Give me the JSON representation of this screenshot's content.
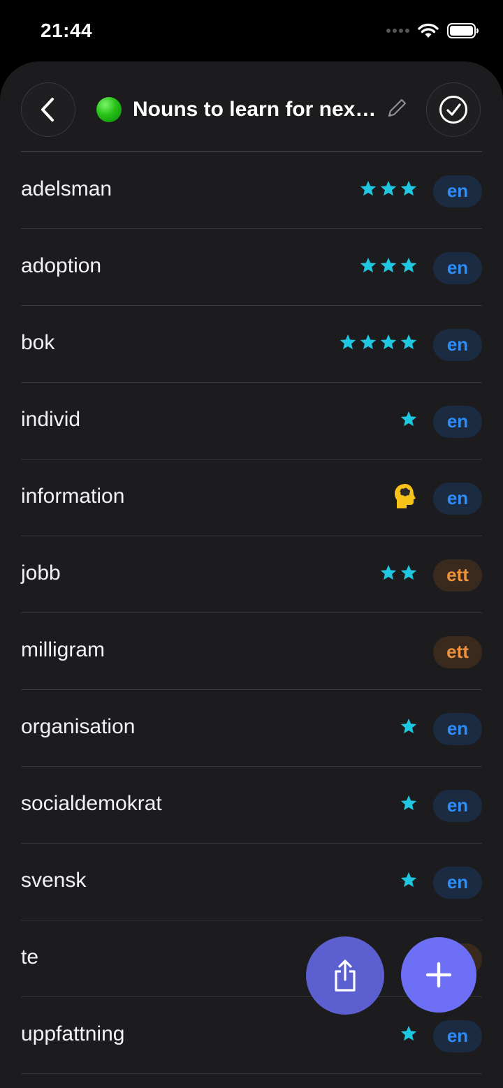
{
  "status": {
    "time": "21:44"
  },
  "header": {
    "title": "Nouns to learn for nex…",
    "back_icon": "chevron-left-icon",
    "edit_icon": "pencil-icon",
    "done_icon": "checkmark-circle-icon",
    "list_color": "#2ecc1f"
  },
  "colors": {
    "star": "#1fc7e0",
    "en": "#2e8cf6",
    "ett": "#f0913b"
  },
  "words": [
    {
      "word": "adelsman",
      "stars": 3,
      "article": "en"
    },
    {
      "word": "adoption",
      "stars": 3,
      "article": "en"
    },
    {
      "word": "bok",
      "stars": 4,
      "article": "en"
    },
    {
      "word": "individ",
      "stars": 1,
      "article": "en"
    },
    {
      "word": "information",
      "stars": 0,
      "brain": true,
      "article": "en"
    },
    {
      "word": "jobb",
      "stars": 2,
      "article": "ett"
    },
    {
      "word": "milligram",
      "stars": 0,
      "article": "ett"
    },
    {
      "word": "organisation",
      "stars": 1,
      "article": "en"
    },
    {
      "word": "socialdemokrat",
      "stars": 1,
      "article": "en"
    },
    {
      "word": "svensk",
      "stars": 1,
      "article": "en"
    },
    {
      "word": "te",
      "stars": 0,
      "article": "ett"
    },
    {
      "word": "uppfattning",
      "stars": 1,
      "article": "en"
    }
  ],
  "fab": {
    "share_icon": "share-icon",
    "add_icon": "plus-icon"
  }
}
